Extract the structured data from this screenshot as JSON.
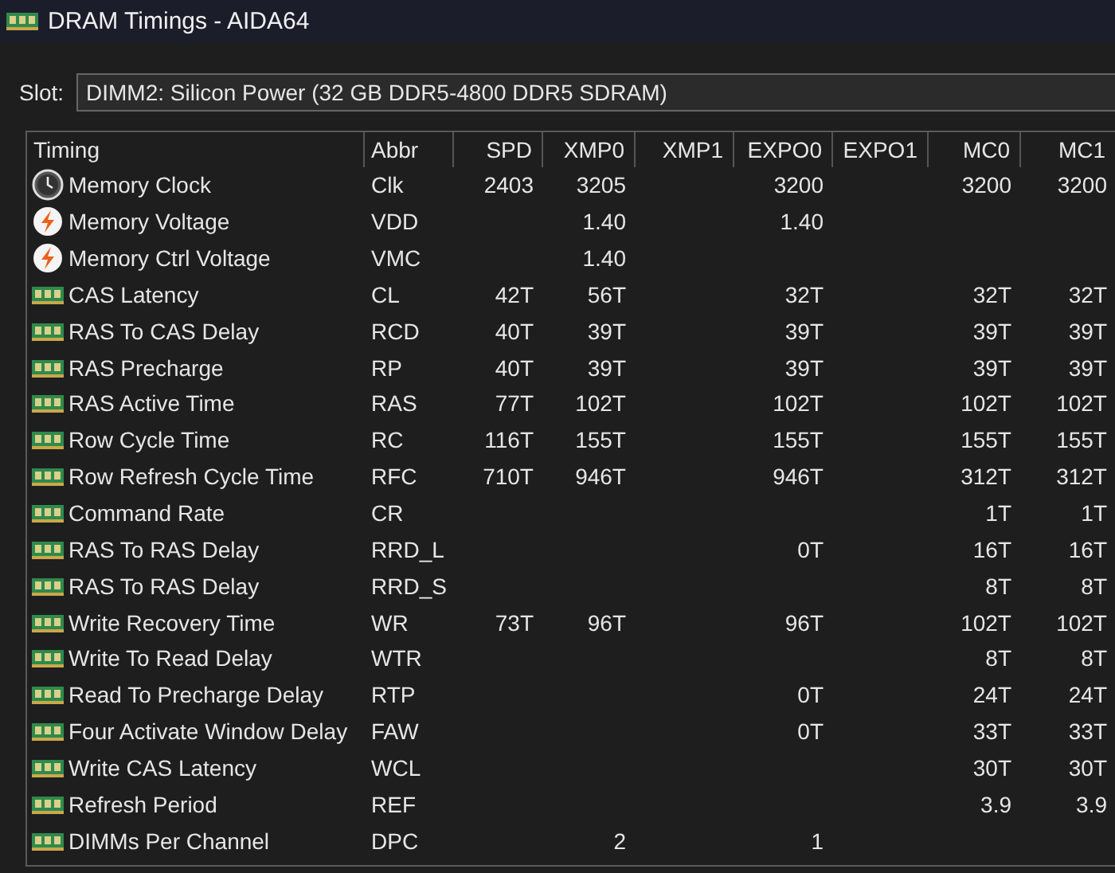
{
  "window": {
    "title": "DRAM Timings - AIDA64"
  },
  "slot": {
    "label": "Slot:",
    "value": "DIMM2: Silicon Power (32 GB DDR5-4800 DDR5 SDRAM)"
  },
  "table": {
    "columns": [
      "Timing",
      "Abbr",
      "SPD",
      "XMP0",
      "XMP1",
      "EXPO0",
      "EXPO1",
      "MC0",
      "MC1"
    ],
    "rows": [
      {
        "kind": "clock",
        "name": "Memory Clock",
        "abbr": "Clk",
        "spd": "2403",
        "xmp0": "3205",
        "expo0": "3200",
        "mc0": "3200",
        "mc1": "3200"
      },
      {
        "kind": "voltage",
        "name": "Memory Voltage",
        "abbr": "VDD",
        "xmp0": "1.40",
        "expo0": "1.40"
      },
      {
        "kind": "voltage",
        "name": "Memory Ctrl Voltage",
        "abbr": "VMC",
        "xmp0": "1.40"
      },
      {
        "kind": "timing",
        "name": "CAS Latency",
        "abbr": "CL",
        "spd": "42T",
        "xmp0": "56T",
        "expo0": "32T",
        "mc0": "32T",
        "mc1": "32T"
      },
      {
        "kind": "timing",
        "name": "RAS To CAS Delay",
        "abbr": "RCD",
        "spd": "40T",
        "xmp0": "39T",
        "expo0": "39T",
        "mc0": "39T",
        "mc1": "39T"
      },
      {
        "kind": "timing",
        "name": "RAS Precharge",
        "abbr": "RP",
        "spd": "40T",
        "xmp0": "39T",
        "expo0": "39T",
        "mc0": "39T",
        "mc1": "39T"
      },
      {
        "kind": "timing",
        "name": "RAS Active Time",
        "abbr": "RAS",
        "spd": "77T",
        "xmp0": "102T",
        "expo0": "102T",
        "mc0": "102T",
        "mc1": "102T"
      },
      {
        "kind": "timing",
        "name": "Row Cycle Time",
        "abbr": "RC",
        "spd": "116T",
        "xmp0": "155T",
        "expo0": "155T",
        "mc0": "155T",
        "mc1": "155T"
      },
      {
        "kind": "timing",
        "name": "Row Refresh Cycle Time",
        "abbr": "RFC",
        "spd": "710T",
        "xmp0": "946T",
        "expo0": "946T",
        "mc0": "312T",
        "mc1": "312T"
      },
      {
        "kind": "timing",
        "name": "Command Rate",
        "abbr": "CR",
        "mc0": "1T",
        "mc1": "1T"
      },
      {
        "kind": "timing",
        "name": "RAS To RAS Delay",
        "abbr": "RRD_L",
        "expo0": "0T",
        "mc0": "16T",
        "mc1": "16T"
      },
      {
        "kind": "timing",
        "name": "RAS To RAS Delay",
        "abbr": "RRD_S",
        "mc0": "8T",
        "mc1": "8T"
      },
      {
        "kind": "timing",
        "name": "Write Recovery Time",
        "abbr": "WR",
        "spd": "73T",
        "xmp0": "96T",
        "expo0": "96T",
        "mc0": "102T",
        "mc1": "102T"
      },
      {
        "kind": "timing",
        "name": "Write To Read Delay",
        "abbr": "WTR",
        "mc0": "8T",
        "mc1": "8T"
      },
      {
        "kind": "timing",
        "name": "Read To Precharge Delay",
        "abbr": "RTP",
        "expo0": "0T",
        "mc0": "24T",
        "mc1": "24T"
      },
      {
        "kind": "timing",
        "name": "Four Activate Window Delay",
        "abbr": "FAW",
        "expo0": "0T",
        "mc0": "33T",
        "mc1": "33T"
      },
      {
        "kind": "timing",
        "name": "Write CAS Latency",
        "abbr": "WCL",
        "mc0": "30T",
        "mc1": "30T"
      },
      {
        "kind": "timing",
        "name": "Refresh Period",
        "abbr": "REF",
        "mc0": "3.9",
        "mc1": "3.9"
      },
      {
        "kind": "timing",
        "name": "DIMMs Per Channel",
        "abbr": "DPC",
        "xmp0": "2",
        "expo0": "1"
      }
    ]
  }
}
